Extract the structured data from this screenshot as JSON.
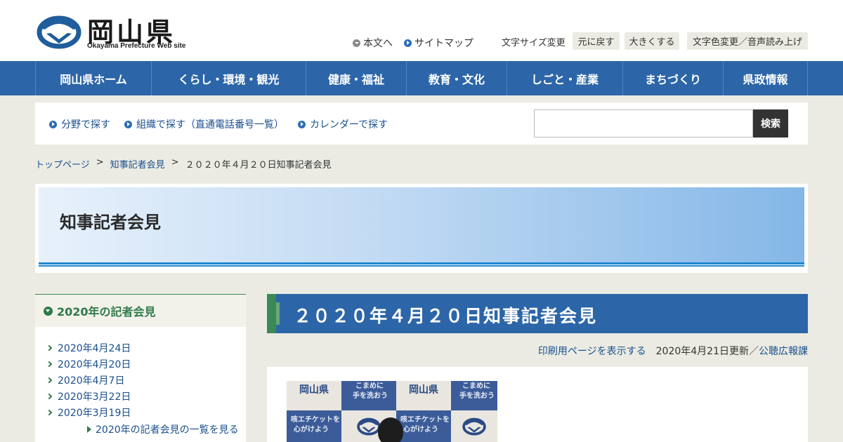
{
  "header": {
    "logo_title": "岡山県",
    "logo_subtitle": "Okayama Prefecture Web site",
    "skip_link": "本文へ",
    "sitemap_link": "サイトマップ",
    "font_size_label": "文字サイズ変更",
    "reset_button": "元に戻す",
    "enlarge_button": "大きくする",
    "color_voice_button": "文字色変更／音声読み上げ"
  },
  "gnav": {
    "items": [
      {
        "label": "岡山県ホーム"
      },
      {
        "label": "くらし・環境・観光"
      },
      {
        "label": "健康・福祉"
      },
      {
        "label": "教育・文化"
      },
      {
        "label": "しごと・産業"
      },
      {
        "label": "まちづくり"
      },
      {
        "label": "県政情報"
      }
    ]
  },
  "search": {
    "links": [
      {
        "label": "分野で探す"
      },
      {
        "label": "組織で探す（直通電話番号一覧）"
      },
      {
        "label": "カレンダーで探す"
      }
    ],
    "input_value": "",
    "button_label": "検索"
  },
  "breadcrumb": {
    "items": [
      "トップページ",
      "知事記者会見",
      "２０２０年４月２０日知事記者会見"
    ],
    "separator": ">"
  },
  "banner": {
    "title": "知事記者会見"
  },
  "sidenav": {
    "heading": "2020年の記者会見",
    "items": [
      "2020年4月24日",
      "2020年4月20日",
      "2020年4月7日",
      "2020年3月22日",
      "2020年3月19日"
    ],
    "more_link": "2020年の記者会見の一覧を見る"
  },
  "main": {
    "title": "２０２０年４月２０日知事記者会見",
    "print_link": "印刷用ページを表示する",
    "updated": "2020年4月21日更新／",
    "department": "公聴広報課",
    "photo_backdrop": {
      "label_okayama": "岡山県",
      "hand_wash_1": "こまめに",
      "hand_wash_2": "手を洗おう",
      "cough_1": "咳エチケットを",
      "cough_2": "心がけよう"
    }
  },
  "colors": {
    "nav_blue": "#2c66a8",
    "accent_green": "#3a8a55",
    "link_blue": "#1a4f8c",
    "page_bg": "#ebebe3"
  }
}
